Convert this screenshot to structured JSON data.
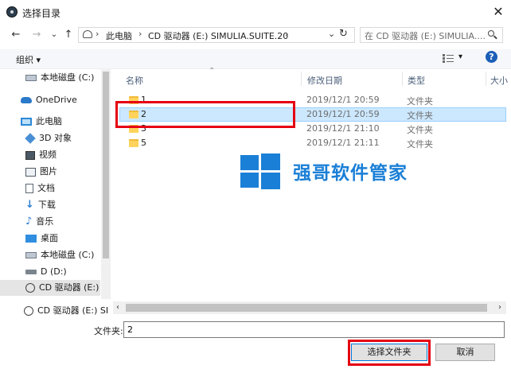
{
  "window": {
    "title": "选择目录"
  },
  "nav": {
    "back": "←",
    "forward": "→",
    "recent": "⌄",
    "up": "↑",
    "breadcrumb": [
      "此电脑",
      "CD 驱动器 (E:) SIMULIA.SUITE.20"
    ],
    "search_placeholder": "在 CD 驱动器 (E:) SIMULIA...."
  },
  "toolbar": {
    "organize": "组织 ▾"
  },
  "sidebar": {
    "items": [
      {
        "label": "本地磁盘 (C:)",
        "icon": "drive-icon"
      },
      {
        "label": "OneDrive",
        "icon": "onedrive-icon"
      },
      {
        "label": "此电脑",
        "icon": "pc-icon"
      },
      {
        "label": "3D 对象",
        "icon": "3d-objects-icon"
      },
      {
        "label": "视频",
        "icon": "video-icon"
      },
      {
        "label": "图片",
        "icon": "pictures-icon"
      },
      {
        "label": "文档",
        "icon": "documents-icon"
      },
      {
        "label": "下载",
        "icon": "download-icon"
      },
      {
        "label": "音乐",
        "icon": "music-icon"
      },
      {
        "label": "桌面",
        "icon": "desktop-icon"
      },
      {
        "label": "本地磁盘 (C:)",
        "icon": "drive-icon"
      },
      {
        "label": "D (D:)",
        "icon": "drive-icon"
      },
      {
        "label": "CD 驱动器 (E:) S",
        "icon": "cd-drive-icon"
      }
    ],
    "bottom": "CD 驱动器 (E:) SI"
  },
  "columns": {
    "name": "名称",
    "date": "修改日期",
    "type": "类型",
    "size": "大小"
  },
  "files": [
    {
      "name": "1",
      "date": "2019/12/1 20:59",
      "type": "文件夹"
    },
    {
      "name": "2",
      "date": "2019/12/1 20:59",
      "type": "文件夹"
    },
    {
      "name": "3",
      "date": "2019/12/1 21:10",
      "type": "文件夹"
    },
    {
      "name": "5",
      "date": "2019/12/1 21:11",
      "type": "文件夹"
    }
  ],
  "watermark": "强哥软件管家",
  "footer": {
    "folder_label": "文件夹:",
    "folder_value": "2",
    "select_button": "选择文件夹",
    "cancel_button": "取消"
  },
  "colors": {
    "accent": "#0078d7",
    "highlight": "#e50012",
    "selection": "#cce8ff",
    "watermark": "#1a7fd6"
  }
}
